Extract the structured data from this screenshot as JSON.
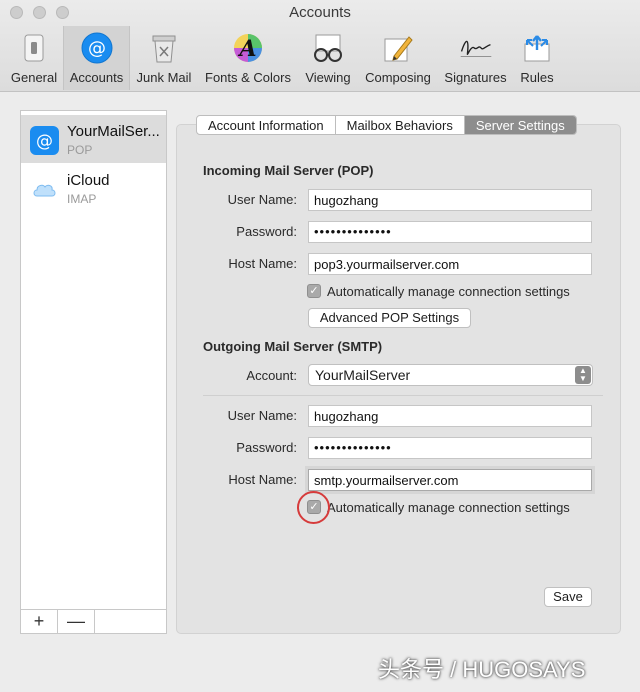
{
  "window": {
    "title": "Accounts"
  },
  "toolbar": {
    "items": [
      {
        "label": "General",
        "icon": "general-switch-icon"
      },
      {
        "label": "Accounts",
        "icon": "at-sign-icon"
      },
      {
        "label": "Junk Mail",
        "icon": "trash-bin-icon"
      },
      {
        "label": "Fonts & Colors",
        "icon": "font-a-icon"
      },
      {
        "label": "Viewing",
        "icon": "eyeglasses-icon"
      },
      {
        "label": "Composing",
        "icon": "pencil-icon"
      },
      {
        "label": "Signatures",
        "icon": "signature-icon"
      },
      {
        "label": "Rules",
        "icon": "rules-arrows-icon"
      }
    ],
    "active": "Accounts"
  },
  "sidebar": {
    "accounts": [
      {
        "name": "YourMailServer",
        "display_name": "YourMailSer...",
        "type": "POP",
        "icon": "at-sign-icon"
      },
      {
        "name": "iCloud",
        "display_name": "iCloud",
        "type": "IMAP",
        "icon": "icloud-icon"
      }
    ],
    "add_label": "+",
    "remove_label": "—"
  },
  "tabs": [
    {
      "label": "Account Information"
    },
    {
      "label": "Mailbox Behaviors"
    },
    {
      "label": "Server Settings"
    }
  ],
  "active_tab": "Server Settings",
  "incoming": {
    "title": "Incoming Mail Server (POP)",
    "user_name_label": "User Name:",
    "user_name": "hugozhang",
    "password_label": "Password:",
    "password": "••••••••••••••",
    "host_name_label": "Host Name:",
    "host_name": "pop3.yourmailserver.com",
    "auto_manage_label": "Automatically manage connection settings",
    "auto_manage_checked": true,
    "advanced_button": "Advanced POP Settings"
  },
  "outgoing": {
    "title": "Outgoing Mail Server (SMTP)",
    "account_label": "Account:",
    "account_value": "YourMailServer",
    "user_name_label": "User Name:",
    "user_name": "hugozhang",
    "password_label": "Password:",
    "password": "••••••••••••••",
    "host_name_label": "Host Name:",
    "host_name": "smtp.yourmailserver.com",
    "auto_manage_label": "Automatically manage connection settings",
    "auto_manage_checked": true
  },
  "save_button": "Save",
  "watermark": "头条号 / HUGOSAYS",
  "colors": {
    "highlight_ring": "#d63b3b",
    "active_tab": "#8d8d8d",
    "accounts_icon": "#1a8cf0"
  }
}
